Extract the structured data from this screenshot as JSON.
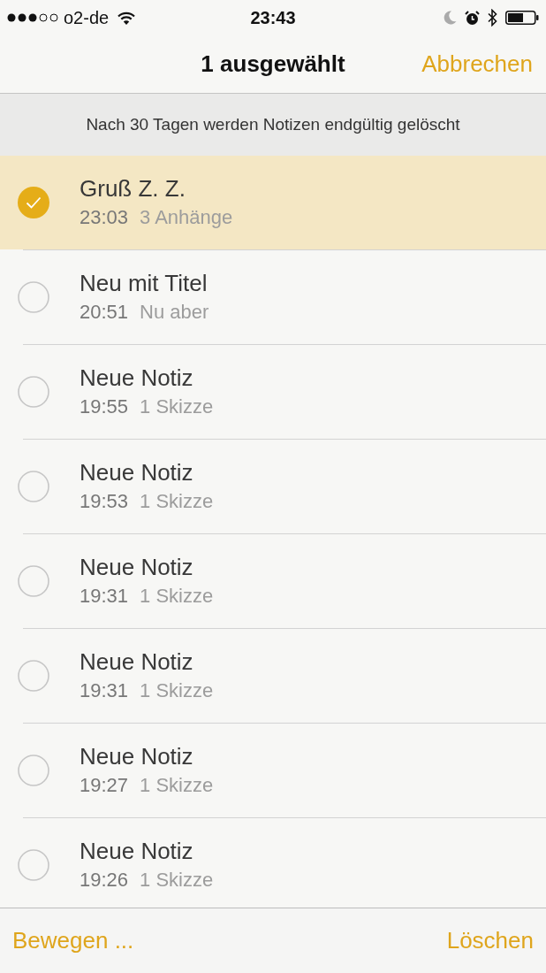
{
  "status_bar": {
    "carrier": "o2-de",
    "time": "23:43"
  },
  "nav_bar": {
    "title": "1 ausgewählt",
    "cancel_button": "Abbrechen"
  },
  "banner": "Nach 30 Tagen werden Notizen endgültig gelöscht",
  "notes": [
    {
      "title": "Gruß Z. Z.",
      "time": "23:03",
      "detail": "3 Anhänge",
      "selected": true
    },
    {
      "title": "Neu mit Titel",
      "time": "20:51",
      "detail": "Nu aber",
      "selected": false
    },
    {
      "title": "Neue Notiz",
      "time": "19:55",
      "detail": "1 Skizze",
      "selected": false
    },
    {
      "title": "Neue Notiz",
      "time": "19:53",
      "detail": "1 Skizze",
      "selected": false
    },
    {
      "title": "Neue Notiz",
      "time": "19:31",
      "detail": "1 Skizze",
      "selected": false
    },
    {
      "title": "Neue Notiz",
      "time": "19:31",
      "detail": "1 Skizze",
      "selected": false
    },
    {
      "title": "Neue Notiz",
      "time": "19:27",
      "detail": "1 Skizze",
      "selected": false
    },
    {
      "title": "Neue Notiz",
      "time": "19:26",
      "detail": "1 Skizze",
      "selected": false
    }
  ],
  "toolbar": {
    "move_button": "Bewegen ...",
    "delete_button": "Löschen"
  }
}
